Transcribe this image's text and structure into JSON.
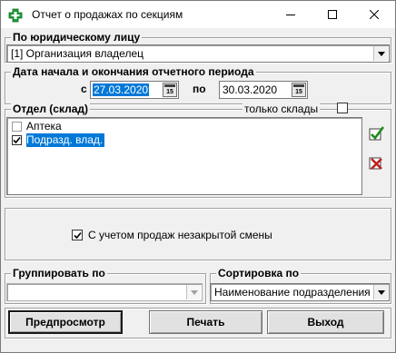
{
  "window": {
    "title": "Отчет о продажах по секциям",
    "minimize_glyph": "–",
    "maximize_glyph": "☐",
    "close_glyph": "✕"
  },
  "legal_entity": {
    "title": "По юридическому лицу",
    "selected": "[1] Организация владелец"
  },
  "period": {
    "title": "Дата начала и окончания отчетного периода",
    "from_label": "с",
    "from_value": "27.03.2020",
    "to_label": "по",
    "to_value": "30.03.2020",
    "calendar_glyph": "15"
  },
  "department": {
    "title": "Отдел (склад)",
    "only_warehouses_label": "только склады",
    "only_warehouses_checked": false,
    "items": [
      {
        "label": "Аптека",
        "checked": false,
        "selected": false
      },
      {
        "label": "Подразд. влад.",
        "checked": true,
        "selected": true
      }
    ]
  },
  "options": {
    "unclosed_shift_label": "С учетом продаж незакрытой смены",
    "unclosed_shift_checked": true
  },
  "grouping": {
    "title": "Группировать по",
    "selected": ""
  },
  "sorting": {
    "title": "Сортировка по",
    "selected": "Наименование подразделения"
  },
  "buttons": {
    "preview": "Предпросмотр",
    "print": "Печать",
    "exit": "Выход"
  },
  "icons": {
    "app": "green-cross-icon",
    "select_all": "check-all-icon",
    "clear_all": "uncheck-all-icon"
  },
  "colors": {
    "selection": "#0078d7",
    "app_icon": "#1e9e3a"
  }
}
